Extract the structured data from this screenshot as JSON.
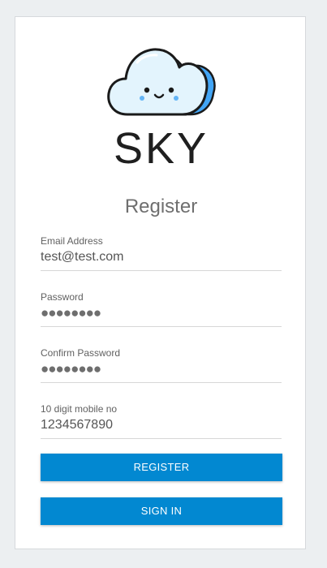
{
  "logo": {
    "icon": "cloud-mascot-icon",
    "text": "SKY"
  },
  "form": {
    "title": "Register",
    "fields": [
      {
        "label": "Email Address",
        "value": "test@test.com",
        "type": "email"
      },
      {
        "label": "Password",
        "value": "●●●●●●●●",
        "type": "password"
      },
      {
        "label": "Confirm Password",
        "value": "●●●●●●●●",
        "type": "password"
      },
      {
        "label": "10 digit mobile no",
        "value": "1234567890",
        "type": "tel"
      }
    ]
  },
  "buttons": {
    "register": "REGISTER",
    "signin": "SIGN IN"
  },
  "colors": {
    "primary": "#0288d1",
    "background": "#eceff1",
    "cloud_fill": "#e3f4fd",
    "cloud_accent": "#42a5f5"
  }
}
